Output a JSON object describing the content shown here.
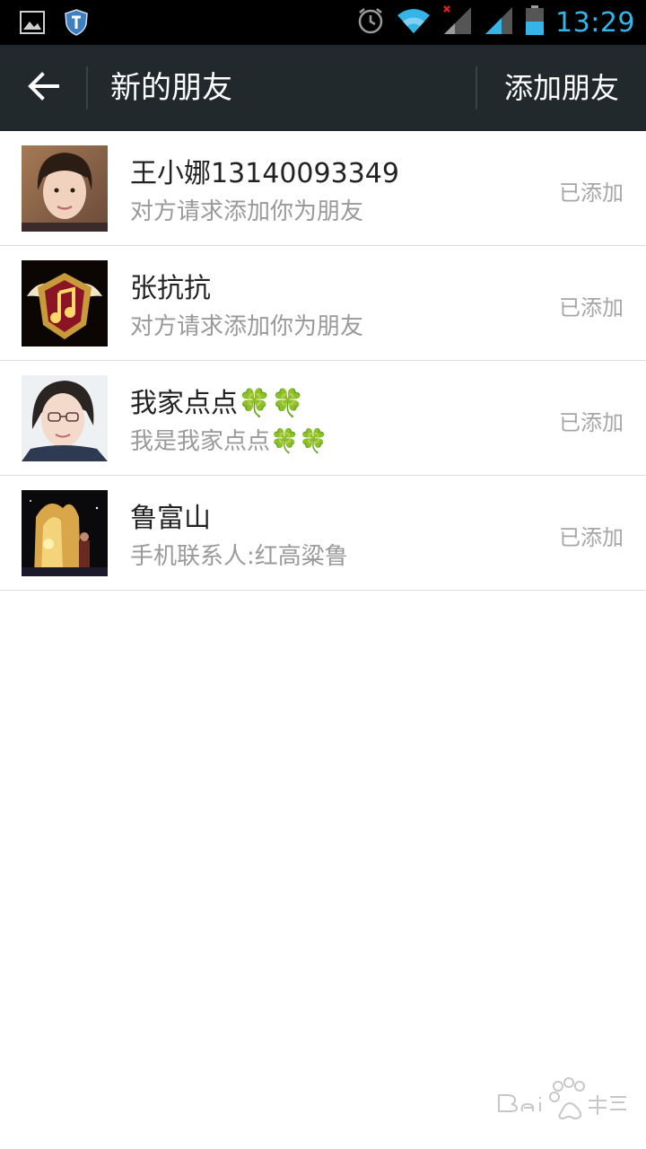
{
  "status_bar": {
    "time": "13:29",
    "icons": [
      "gallery-icon",
      "shield-icon",
      "alarm-icon",
      "wifi-icon",
      "signal-icon",
      "signal-icon",
      "battery-icon"
    ],
    "accent_color": "#35b4e8"
  },
  "header": {
    "title": "新的朋友",
    "action_label": "添加朋友",
    "back_icon": "arrow-left-icon"
  },
  "friends": [
    {
      "name": "王小娜13140093349",
      "subtitle": "对方请求添加你为朋友",
      "status": "已添加"
    },
    {
      "name": "张抗抗",
      "subtitle": "对方请求添加你为朋友",
      "status": "已添加"
    },
    {
      "name": "我家点点🍀🍀",
      "subtitle": "我是我家点点🍀🍀",
      "status": "已添加"
    },
    {
      "name": "鲁富山",
      "subtitle": "手机联系人:红高粱鲁",
      "status": "已添加"
    }
  ],
  "colors": {
    "action_bar": "#22292c",
    "status_text": "#a6a6a6",
    "subtitle_text": "#9a9a9a"
  }
}
